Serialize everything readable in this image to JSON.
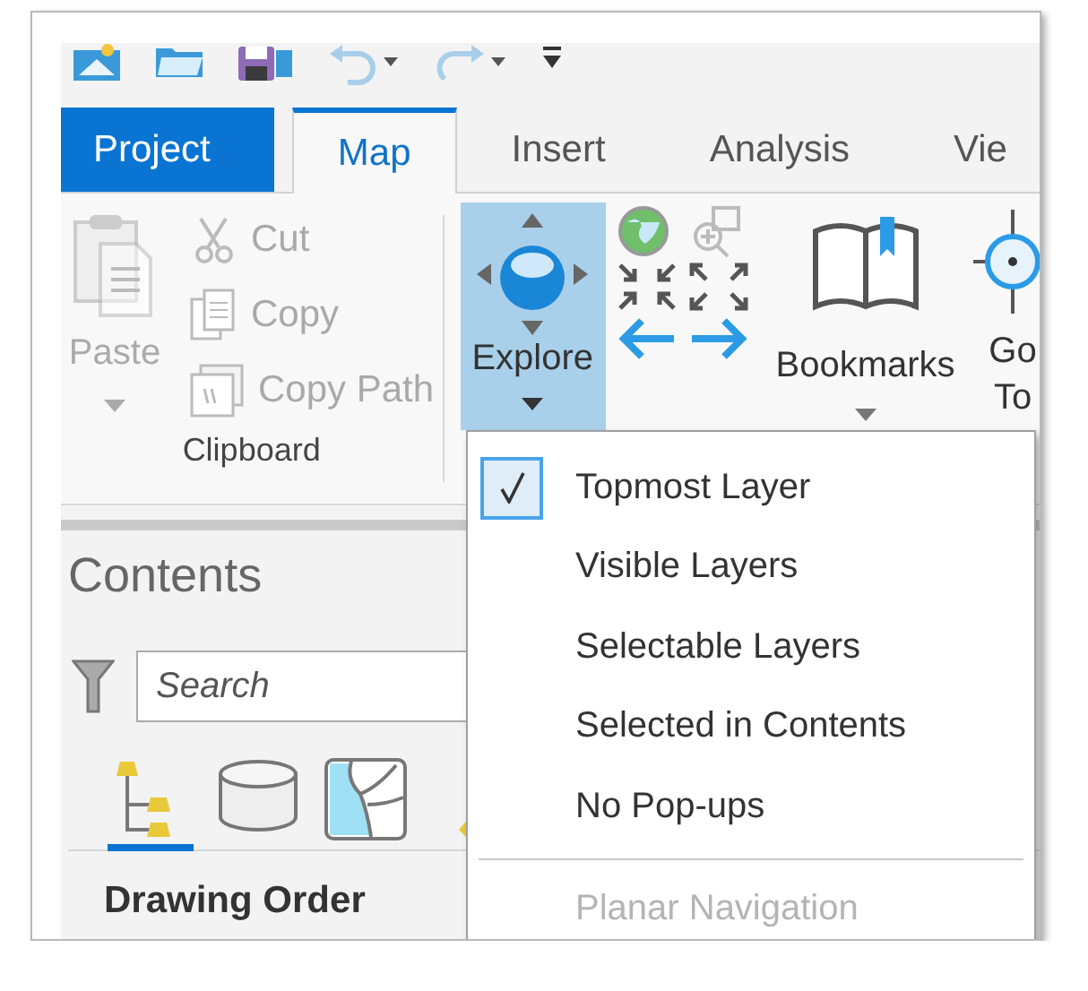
{
  "tabs": [
    {
      "label": "Project",
      "kind": "backstage",
      "selected": false
    },
    {
      "label": "Map",
      "kind": "tab",
      "selected": true
    },
    {
      "label": "Insert",
      "kind": "tab",
      "selected": false
    },
    {
      "label": "Analysis",
      "kind": "tab",
      "selected": false
    },
    {
      "label": "Vie",
      "kind": "tab",
      "selected": false
    }
  ],
  "ribbon": {
    "clipboard": {
      "paste": {
        "label": "Paste",
        "disabled": true
      },
      "commands": [
        {
          "label": "Cut",
          "kind": "cut",
          "disabled": true
        },
        {
          "label": "Copy",
          "kind": "copy",
          "disabled": true
        },
        {
          "label": "Copy Path",
          "kind": "copy-path",
          "disabled": true
        }
      ],
      "group_label": "Clipboard"
    },
    "explore": {
      "label": "Explore",
      "expanded": true
    },
    "bookmarks": {
      "label": "Bookmarks"
    },
    "go_to": {
      "label": "Go To"
    }
  },
  "menu": {
    "items": [
      {
        "kind": "option",
        "label": "Topmost Layer",
        "checked": true,
        "disabled": false
      },
      {
        "kind": "option",
        "label": "Visible Layers",
        "checked": false,
        "disabled": false
      },
      {
        "kind": "option",
        "label": "Selectable Layers",
        "checked": false,
        "disabled": false
      },
      {
        "kind": "option",
        "label": "Selected in Contents",
        "checked": false,
        "disabled": false
      },
      {
        "kind": "option",
        "label": "No Pop-ups",
        "checked": false,
        "disabled": false
      },
      {
        "kind": "separator"
      },
      {
        "kind": "option",
        "label": "Planar Navigation",
        "checked": false,
        "disabled": true
      }
    ]
  },
  "contents": {
    "title": "Contents",
    "search": {
      "placeholder": "Search"
    },
    "views": [
      {
        "kind": "tree",
        "selected": true
      },
      {
        "kind": "source",
        "selected": false
      },
      {
        "kind": "map",
        "selected": false
      },
      {
        "kind": "edit",
        "selected": false
      }
    ],
    "section": "Drawing Order"
  }
}
